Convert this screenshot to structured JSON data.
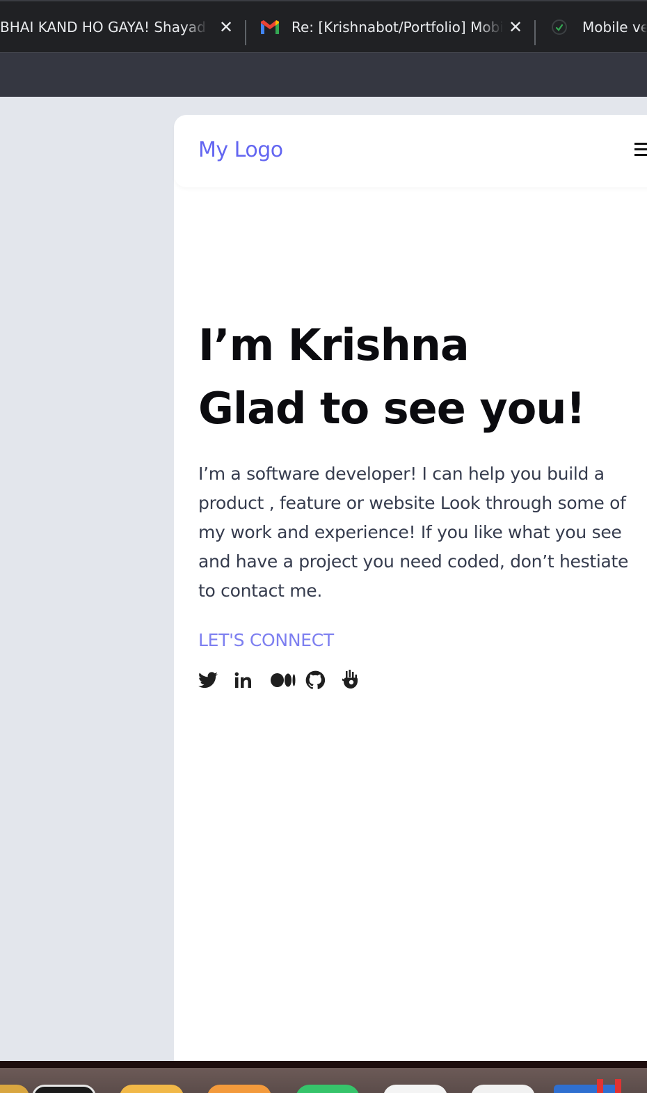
{
  "browser": {
    "tabs": [
      {
        "title": "BHAI KAND HO GAYA! Shayad I"
      },
      {
        "title": "Re: [Krishnabot/Portfolio] Mobi",
        "icon": "gmail-icon"
      },
      {
        "title": "Mobile ver",
        "icon": "loading-spinner-icon"
      }
    ],
    "close_glyph": "✕"
  },
  "site": {
    "logo": "My Logo",
    "menu_icon": "hamburger-menu-icon",
    "hero": {
      "line1": "I’m Krishna",
      "line2": "Glad to see you!"
    },
    "description": "I’m a software developer! I can help you build a product , feature or website Look through some of my work and experience! If you like what you see and have a project you need coded, don’t hestiate to contact me.",
    "connect_label": "LET'S CONNECT",
    "socials": [
      "twitter-icon",
      "linkedin-icon",
      "medium-icon",
      "github-icon",
      "hashnode-icon"
    ]
  },
  "colors": {
    "accent": "#6366f1",
    "connect": "#7d7ff0",
    "heading": "#0b0b0f",
    "body_text": "#363c4e",
    "page_bg": "#e3e6ec"
  }
}
